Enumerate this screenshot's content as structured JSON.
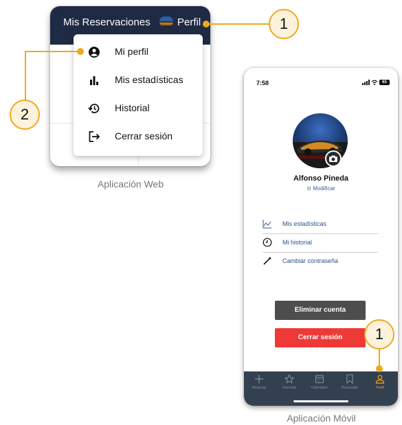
{
  "web": {
    "title": "Mis Reservaciones",
    "profile_label": "Perfil",
    "menu": [
      {
        "label": "Mi perfil",
        "icon": "account-circle-icon"
      },
      {
        "label": "Mis estadísticas",
        "icon": "bar-chart-icon"
      },
      {
        "label": "Historial",
        "icon": "history-icon"
      },
      {
        "label": "Cerrar sesión",
        "icon": "logout-icon"
      }
    ],
    "caption": "Aplicación Web"
  },
  "callouts": {
    "profile": "1",
    "my_profile": "2",
    "tab_profile": "1"
  },
  "mobile": {
    "status": {
      "time": "7:58",
      "battery": "65"
    },
    "user": {
      "name": "Alfonso Pineda",
      "modify": "⊙ Modificar"
    },
    "options": [
      {
        "label": "Mis estadísticas",
        "icon": "line-chart-icon"
      },
      {
        "label": "Mi historial",
        "icon": "clock-icon"
      },
      {
        "label": "Cambiar contraseña",
        "icon": "pencil-icon"
      }
    ],
    "delete_button": "Eliminar cuenta",
    "logout_button": "Cerrar sesión",
    "tabs": [
      {
        "label": "Reservar",
        "icon": "plus-icon"
      },
      {
        "label": "Favoritos",
        "icon": "star-icon"
      },
      {
        "label": "Calendario",
        "icon": "calendar-icon"
      },
      {
        "label": "Reservado",
        "icon": "bookmark-icon"
      },
      {
        "label": "Perfil",
        "icon": "user-icon",
        "active": true
      }
    ],
    "caption": "Aplicación Móvil"
  },
  "colors": {
    "accent": "#f0a81c",
    "header": "#1f2a44",
    "danger": "#ee3a37",
    "tabbar": "#33404f"
  }
}
